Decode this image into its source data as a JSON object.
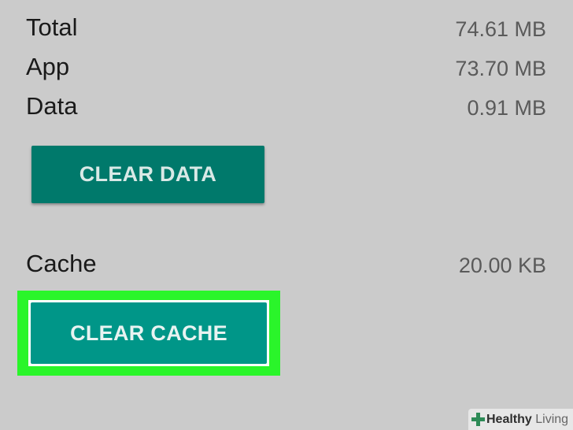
{
  "storage": {
    "rows": [
      {
        "label": "Total",
        "value": "74.61 MB"
      },
      {
        "label": "App",
        "value": "73.70 MB"
      },
      {
        "label": "Data",
        "value": "0.91 MB"
      }
    ],
    "clear_data_label": "CLEAR DATA",
    "cache_label": "Cache",
    "cache_value": "20.00 KB",
    "clear_cache_label": "CLEAR CACHE"
  },
  "highlight_color": "#2af52a",
  "accent_color": "#009688",
  "watermark": {
    "icon": "plus-cross-icon",
    "text_bold": "Healthy",
    "text_light": "Living"
  }
}
